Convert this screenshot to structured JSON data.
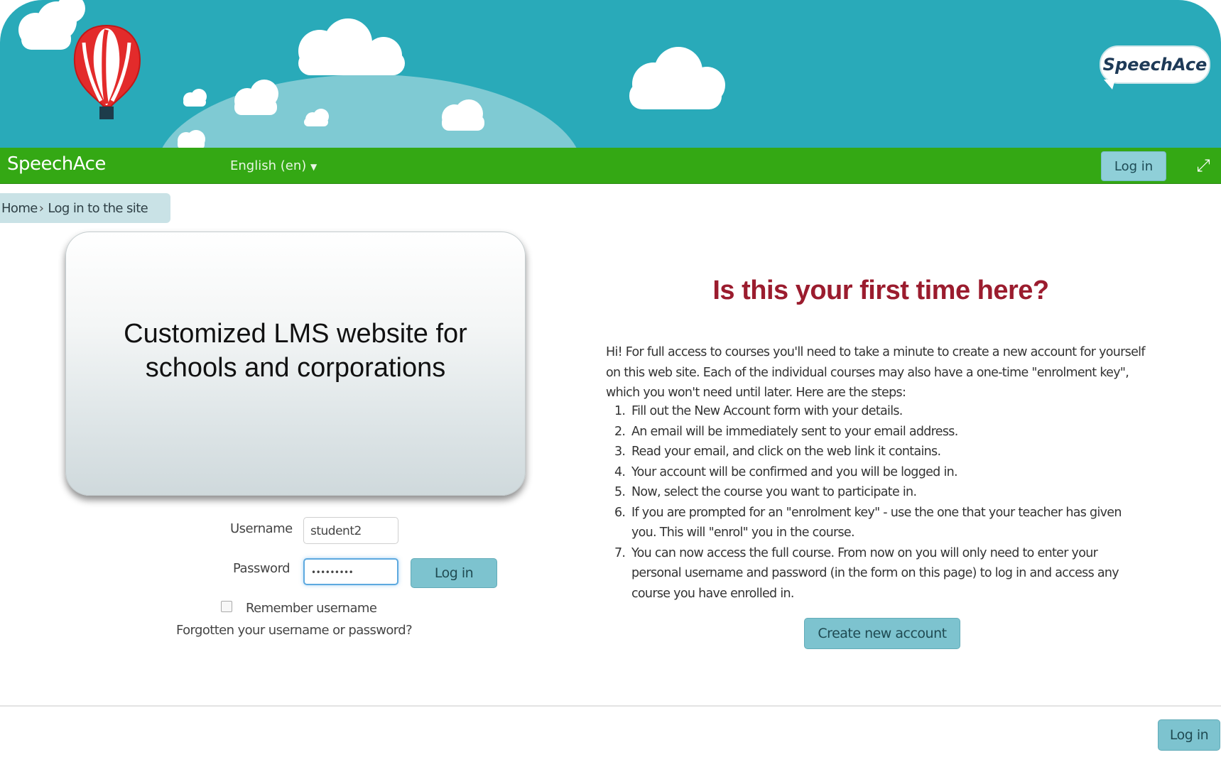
{
  "header": {
    "logo_text": "SpeechAce"
  },
  "navbar": {
    "brand": "SpeechAce",
    "language": "English (en)",
    "login_label": "Log in"
  },
  "breadcrumb": {
    "home": "Home",
    "separator": "›",
    "current": "Log in to the site"
  },
  "overlay": {
    "line1": "Customized LMS website for",
    "line2": "schools and corporations"
  },
  "login_form": {
    "username_label": "Username",
    "username_value": "student2",
    "password_label": "Password",
    "password_value": "•••••••••",
    "login_button": "Log in",
    "remember_label": "Remember username",
    "forgot_link": "Forgotten your username or password?"
  },
  "signup": {
    "heading": "Is this your first time here?",
    "intro": "Hi! For full access to courses you'll need to take a minute to create a new account for yourself on this web site. Each of the individual courses may also have a one-time \"enrolment key\", which you won't need until later. Here are the steps:",
    "steps": [
      {
        "num": "1.",
        "text": "Fill out the New Account form with your details."
      },
      {
        "num": "2.",
        "text": "An email will be immediately sent to your email address."
      },
      {
        "num": "3.",
        "text": "Read your email, and click on the web link it contains."
      },
      {
        "num": "4.",
        "text": "Your account will be confirmed and you will be logged in."
      },
      {
        "num": "5.",
        "text": "Now, select the course you want to participate in."
      },
      {
        "num": "6.",
        "text": "If you are prompted for an \"enrolment key\" - use the one that your teacher has given you. This will \"enrol\" you in the course."
      },
      {
        "num": "7.",
        "text": "You can now access the full course. From now on you will only need to enter your personal username and password (in the form on this page) to log in and access any course you have enrolled in."
      }
    ],
    "create_button": "Create new account"
  },
  "footer": {
    "login_label": "Log in"
  },
  "colors": {
    "banner": "#29aab9",
    "navbar": "#34a814",
    "button": "#7dc3cf",
    "heading": "#9b1c2e"
  },
  "icons": {
    "balloon": "hot-air-balloon-icon",
    "expand": "expand-icon",
    "dropdown": "caret-down-icon"
  }
}
